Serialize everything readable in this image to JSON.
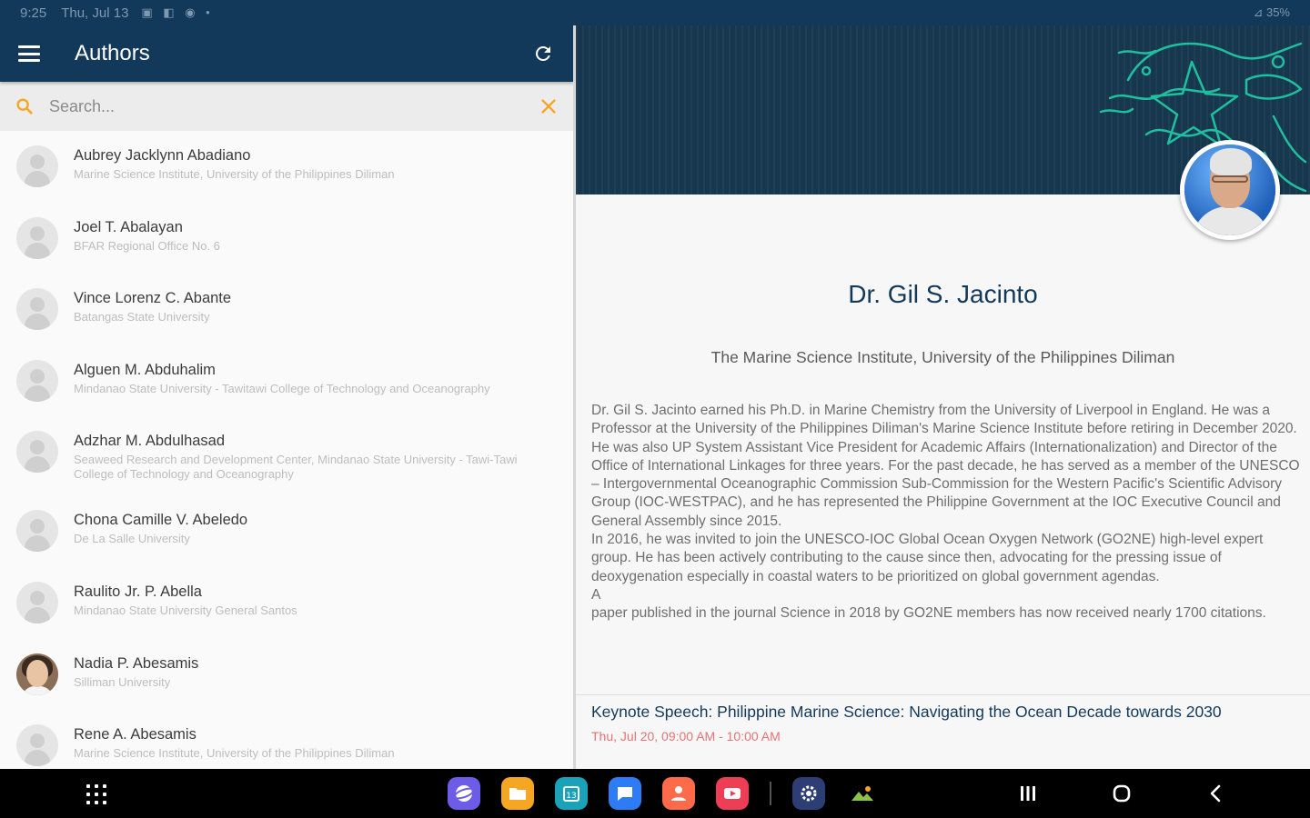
{
  "status_bar": {
    "time": "9:25",
    "date": "Thu, Jul 13",
    "indicators": "▣ ◧ ◉ •",
    "right": "⊿ 35%"
  },
  "app_bar": {
    "title": "Authors"
  },
  "search": {
    "placeholder": "Search..."
  },
  "authors": [
    {
      "name": "Aubrey Jacklynn Abadiano",
      "affiliation": "Marine Science Institute, University of the Philippines Diliman",
      "photo": false
    },
    {
      "name": "Joel T. Abalayan",
      "affiliation": "BFAR Regional Office No. 6",
      "photo": false
    },
    {
      "name": "Vince Lorenz C. Abante",
      "affiliation": "Batangas State University",
      "photo": false
    },
    {
      "name": "Alguen M. Abduhalim",
      "affiliation": "Mindanao State University - Tawitawi College of Technology and Oceanography",
      "photo": false
    },
    {
      "name": "Adzhar M. Abdulhasad",
      "affiliation": "Seaweed Research and Development Center, Mindanao State University - Tawi-Tawi College of Technology and Oceanography",
      "photo": false
    },
    {
      "name": "Chona Camille V. Abeledo",
      "affiliation": "De La Salle University",
      "photo": false
    },
    {
      "name": "Raulito Jr. P. Abella",
      "affiliation": "Mindanao State University General Santos",
      "photo": false
    },
    {
      "name": "Nadia P. Abesamis",
      "affiliation": "Silliman University",
      "photo": true
    },
    {
      "name": "Rene A. Abesamis",
      "affiliation": "Marine Science Institute, University of the Philippines Diliman",
      "photo": false
    }
  ],
  "detail": {
    "name": "Dr. Gil S. Jacinto",
    "institution": "The Marine Science Institute, University of the Philippines Diliman",
    "bio_1": "Dr. Gil S. Jacinto earned his Ph.D. in Marine Chemistry from the University of Liverpool in England. He was a Professor at the University of the Philippines Diliman's Marine Science Institute before retiring in December 2020. He was also UP System Assistant Vice President for Academic Affairs (Internationalization) and Director of the Office of International Linkages for three years. For the past decade, he has served as a member of the UNESCO – Intergovernmental Oceanographic Commission Sub-Commission for the Western Pacific's Scientific Advisory Group (IOC-WESTPAC), and he has represented the Philippine Government at the IOC Executive Council and General Assembly since 2015.",
    "bio_2": "In 2016, he was invited to join the UNESCO-IOC Global Ocean Oxygen Network (GO2NE) high-level expert group. He has been actively contributing to the cause since then, advocating for the pressing issue of deoxygenation especially in coastal waters to be prioritized on global government agendas.",
    "bio_3": "A",
    "bio_4": "paper published in the journal Science in 2018 by GO2NE members has now received nearly 1700 citations.",
    "session_title": "Keynote Speech: Philippine Marine Science: Navigating the Ocean Decade towards 2030",
    "session_time": "Thu, Jul 20, 09:00 AM - 10:00 AM"
  },
  "colors": {
    "primary": "#12395a",
    "accent": "#f5a623",
    "session_time": "#e57373"
  },
  "dock_apps": [
    {
      "name": "internet-app",
      "color": "#6c5ce7"
    },
    {
      "name": "files-app",
      "color": "#f5a623"
    },
    {
      "name": "calendar-app",
      "color": "#1aa3b8"
    },
    {
      "name": "messages-app",
      "color": "#2d7cf6"
    },
    {
      "name": "contacts-app",
      "color": "#ff6b4a"
    },
    {
      "name": "youtube-app",
      "color": "#ee3e55"
    },
    {
      "name": "settings-app",
      "color": "#2c3e73"
    },
    {
      "name": "app-photo",
      "color": "#000000"
    }
  ]
}
